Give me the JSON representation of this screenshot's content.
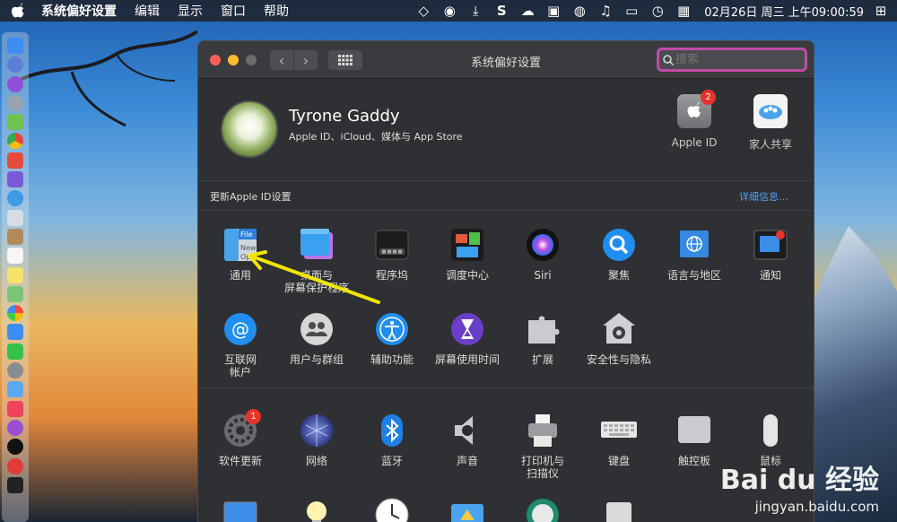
{
  "menubar": {
    "app_name": "系统偏好设置",
    "menus": [
      "编辑",
      "显示",
      "窗口",
      "帮助"
    ],
    "clock": "02月26日 周三 上午09:00:59"
  },
  "window": {
    "title": "系统偏好设置",
    "search_placeholder": "搜索"
  },
  "account": {
    "name": "Tyrone Gaddy",
    "subtitle": "Apple ID、iCloud、媒体与 App Store",
    "apple_id_label": "Apple ID",
    "apple_id_badge": "2",
    "family_label": "家人共享"
  },
  "update": {
    "text": "更新Apple ID设置",
    "link": "详细信息…"
  },
  "row1": [
    {
      "label": "通用",
      "icon": "general-icon"
    },
    {
      "label": "桌面与\n屏幕保护程序",
      "icon": "desktop-icon"
    },
    {
      "label": "程序坞",
      "icon": "dock-icon"
    },
    {
      "label": "调度中心",
      "icon": "mission-control-icon"
    },
    {
      "label": "Siri",
      "icon": "siri-icon"
    },
    {
      "label": "聚焦",
      "icon": "spotlight-icon"
    },
    {
      "label": "语言与地区",
      "icon": "language-icon"
    },
    {
      "label": "通知",
      "icon": "notifications-icon"
    }
  ],
  "row2": [
    {
      "label": "互联网\n帐户",
      "icon": "internet-accounts-icon"
    },
    {
      "label": "用户与群组",
      "icon": "users-icon"
    },
    {
      "label": "辅助功能",
      "icon": "accessibility-icon"
    },
    {
      "label": "屏幕使用时间",
      "icon": "screen-time-icon"
    },
    {
      "label": "扩展",
      "icon": "extensions-icon"
    },
    {
      "label": "安全性与隐私",
      "icon": "security-icon"
    }
  ],
  "row3": [
    {
      "label": "软件更新",
      "icon": "software-update-icon",
      "badge": "1"
    },
    {
      "label": "网络",
      "icon": "network-icon"
    },
    {
      "label": "蓝牙",
      "icon": "bluetooth-icon"
    },
    {
      "label": "声音",
      "icon": "sound-icon"
    },
    {
      "label": "打印机与\n扫描仪",
      "icon": "printer-icon"
    },
    {
      "label": "键盘",
      "icon": "keyboard-icon"
    },
    {
      "label": "触控板",
      "icon": "trackpad-icon"
    },
    {
      "label": "鼠标",
      "icon": "mouse-icon"
    }
  ],
  "general_icon_text": [
    "File",
    "New",
    "Op"
  ],
  "watermark": {
    "logo": "Bai du 经验",
    "url": "jingyan.baidu.com"
  },
  "colors": {
    "window_bg": "#2f3033",
    "link": "#4aa3ff",
    "badge": "#e8322c",
    "search_focus": "#c34aa8",
    "arrow": "#f2e600"
  }
}
